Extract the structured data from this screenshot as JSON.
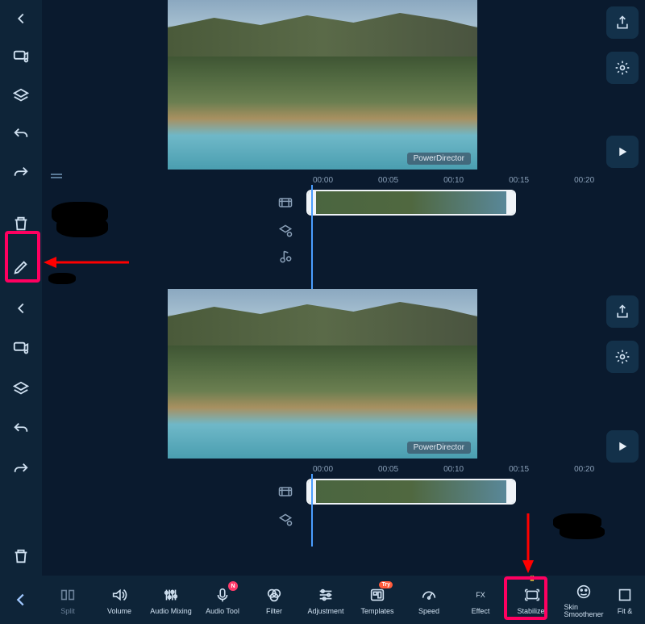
{
  "app": {
    "watermark": "PowerDirector"
  },
  "timeline": {
    "ticks": [
      "00:00",
      "00:05",
      "00:10",
      "00:15",
      "00:20"
    ]
  },
  "toolbar_bottom": {
    "items": [
      {
        "id": "split",
        "label": "Split"
      },
      {
        "id": "volume",
        "label": "Volume"
      },
      {
        "id": "audio_mixing",
        "label": "Audio Mixing"
      },
      {
        "id": "audio_tool",
        "label": "Audio Tool",
        "badge": "N"
      },
      {
        "id": "filter",
        "label": "Filter"
      },
      {
        "id": "adjustment",
        "label": "Adjustment"
      },
      {
        "id": "templates",
        "label": "Templates",
        "badge": "Try"
      },
      {
        "id": "speed",
        "label": "Speed"
      },
      {
        "id": "effect",
        "label": "Effect",
        "text_icon": "FX"
      },
      {
        "id": "stabilizer",
        "label": "Stabilizer",
        "premium": true
      },
      {
        "id": "skin_smoothener",
        "label": "Skin\nSmoothener"
      },
      {
        "id": "fit",
        "label": "Fit &"
      }
    ]
  },
  "left_sidebar_icons": [
    "back",
    "media-music",
    "layers",
    "undo",
    "redo",
    "trash",
    "edit-pencil"
  ],
  "right_sidebar_icons": [
    "export-share",
    "settings-gear",
    "play"
  ]
}
